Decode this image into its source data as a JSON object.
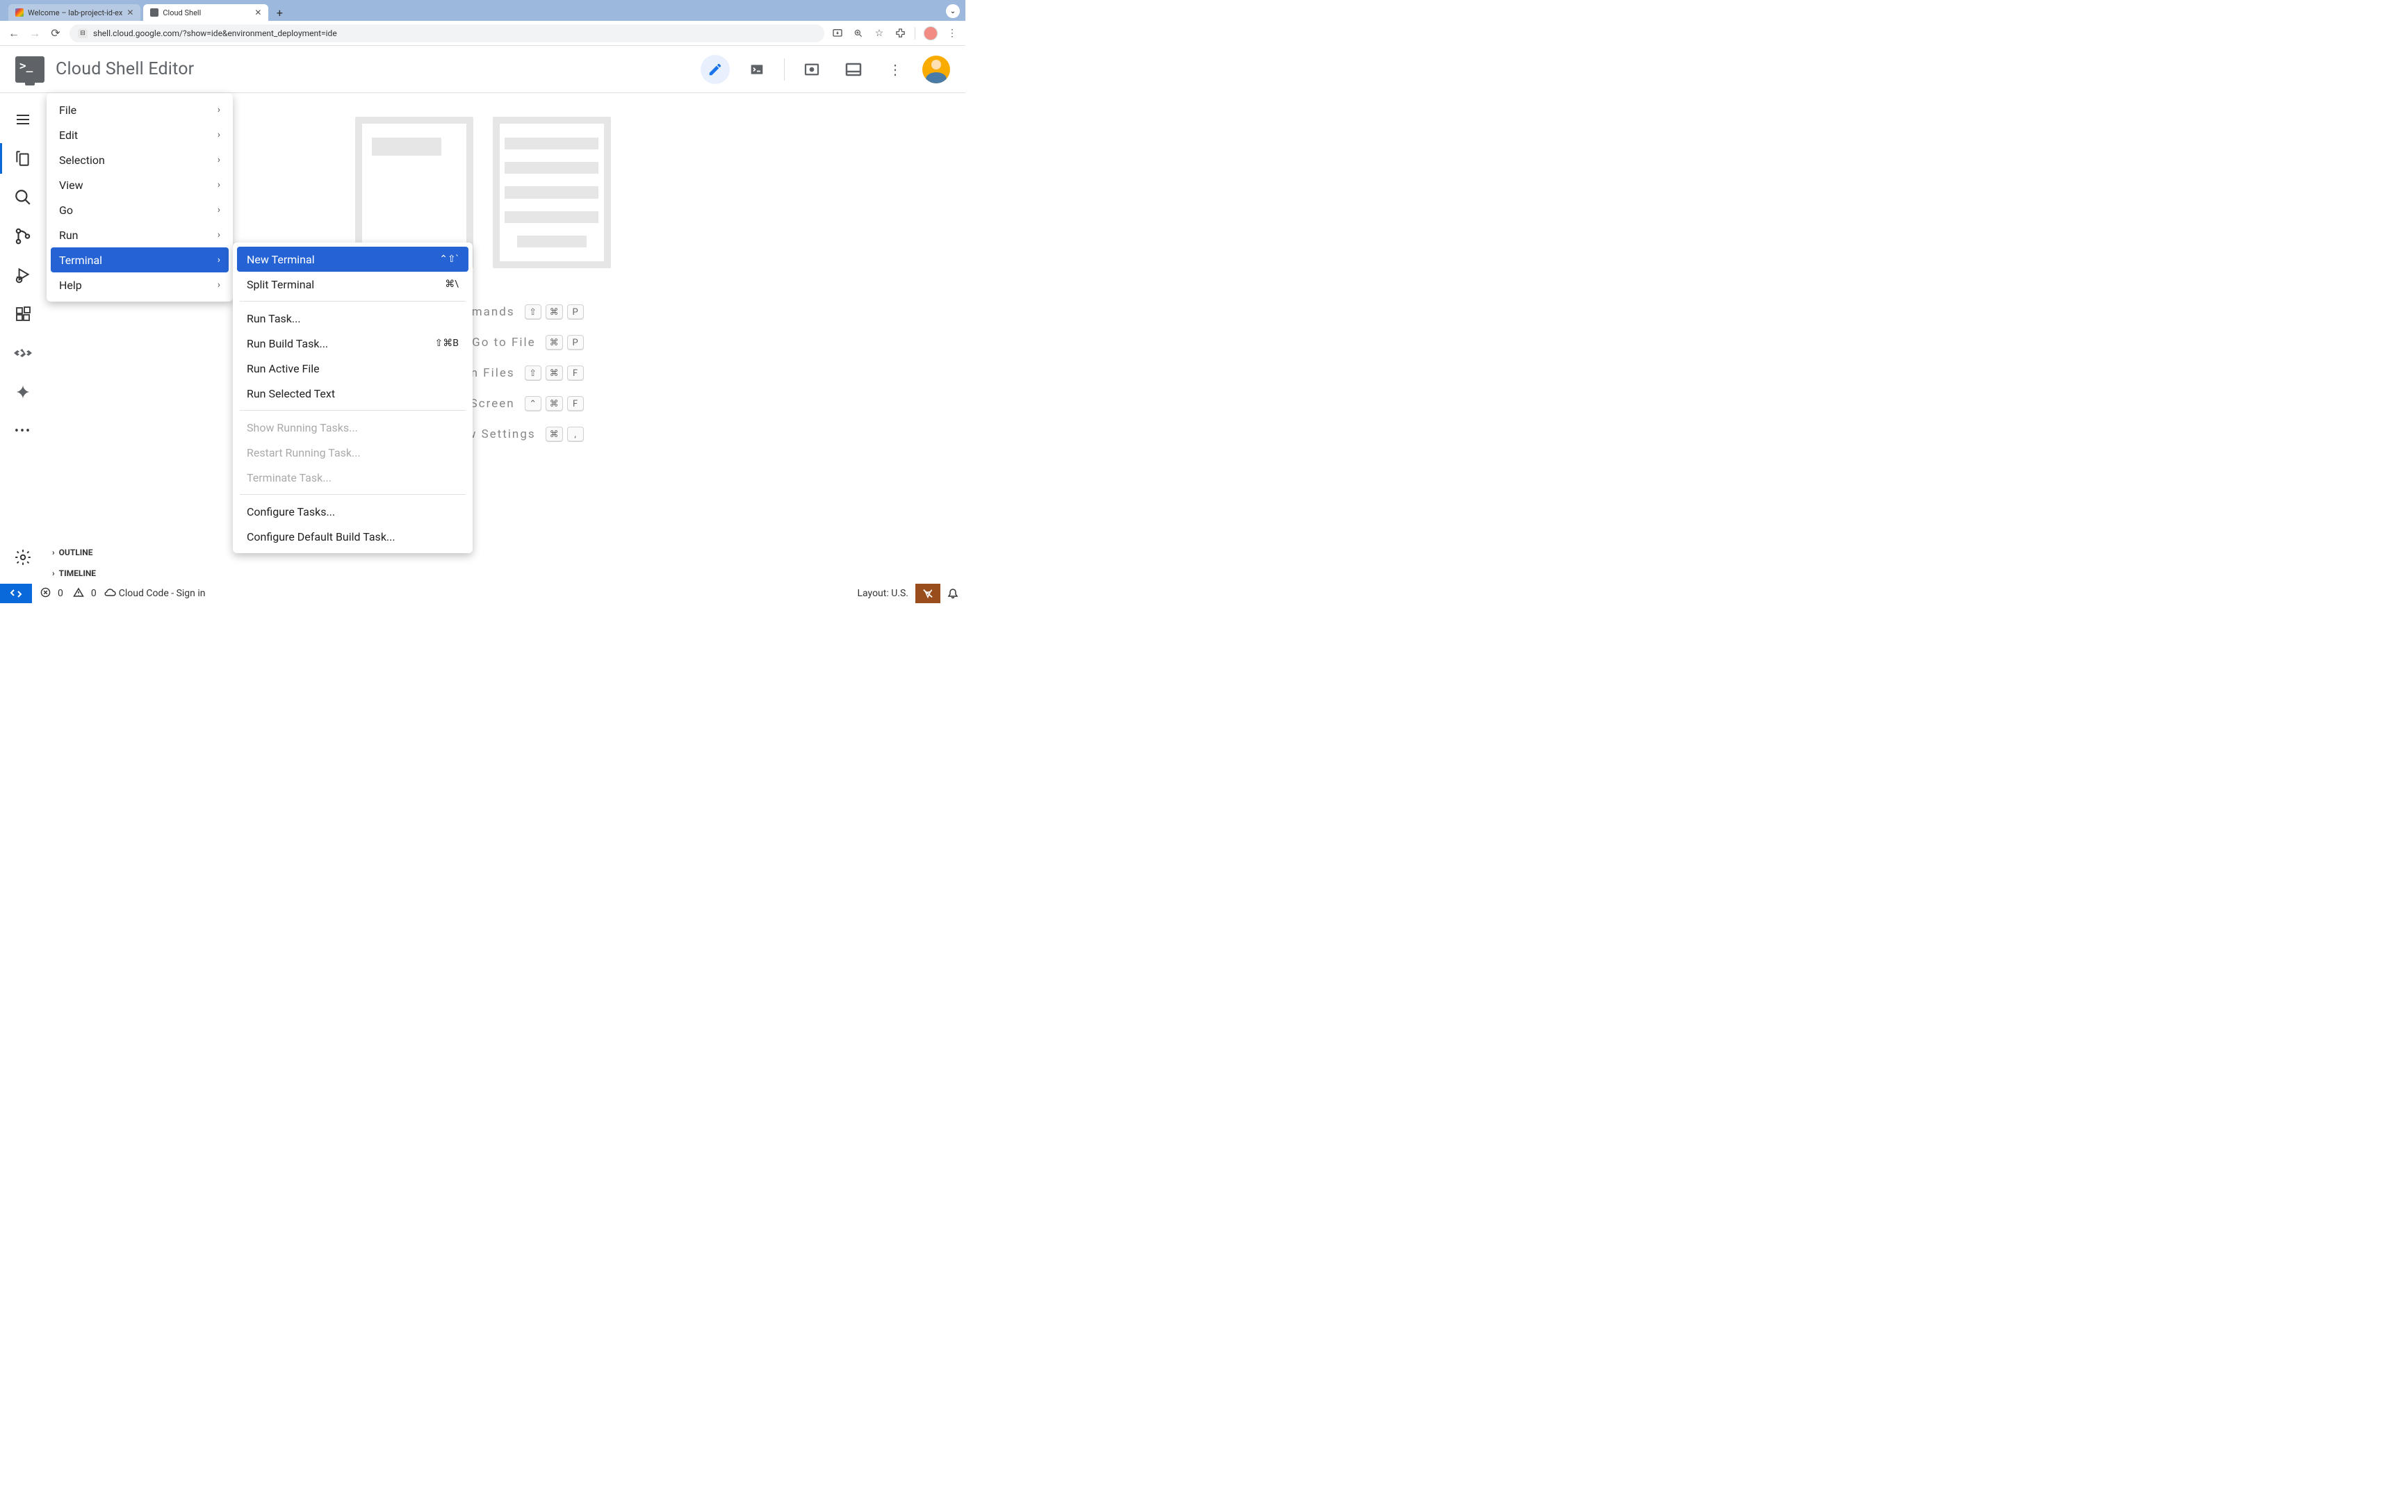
{
  "browser": {
    "tabs": [
      {
        "title": "Welcome – lab-project-id-ex"
      },
      {
        "title": "Cloud Shell"
      }
    ],
    "url": "shell.cloud.google.com/?show=ide&environment_deployment=ide"
  },
  "header": {
    "title": "Cloud Shell Editor"
  },
  "menu": {
    "items": [
      "File",
      "Edit",
      "Selection",
      "View",
      "Go",
      "Run",
      "Terminal",
      "Help"
    ],
    "active": "Terminal"
  },
  "submenu": {
    "groups": [
      [
        {
          "label": "New Terminal",
          "shortcut": "⌃⇧`",
          "hl": true
        },
        {
          "label": "Split Terminal",
          "shortcut": "⌘\\"
        }
      ],
      [
        {
          "label": "Run Task..."
        },
        {
          "label": "Run Build Task...",
          "shortcut": "⇧⌘B"
        },
        {
          "label": "Run Active File"
        },
        {
          "label": "Run Selected Text"
        }
      ],
      [
        {
          "label": "Show Running Tasks...",
          "disabled": true
        },
        {
          "label": "Restart Running Task...",
          "disabled": true
        },
        {
          "label": "Terminate Task...",
          "disabled": true
        }
      ],
      [
        {
          "label": "Configure Tasks..."
        },
        {
          "label": "Configure Default Build Task..."
        }
      ]
    ]
  },
  "sections": {
    "outline": "OUTLINE",
    "timeline": "TIMELINE"
  },
  "welcome": {
    "commands": [
      {
        "label": "Show All Commands",
        "keys": [
          "⇧",
          "⌘",
          "P"
        ]
      },
      {
        "label": "Go to File",
        "keys": [
          "⌘",
          "P"
        ]
      },
      {
        "label": "Find in Files",
        "keys": [
          "⇧",
          "⌘",
          "F"
        ]
      },
      {
        "label": "Toggle Full Screen",
        "keys": [
          "⌃",
          "⌘",
          "F"
        ]
      },
      {
        "label": "Show Settings",
        "keys": [
          "⌘",
          ","
        ]
      }
    ]
  },
  "status": {
    "errors": "0",
    "warnings": "0",
    "cloud_code": "Cloud Code - Sign in",
    "layout": "Layout: U.S."
  }
}
